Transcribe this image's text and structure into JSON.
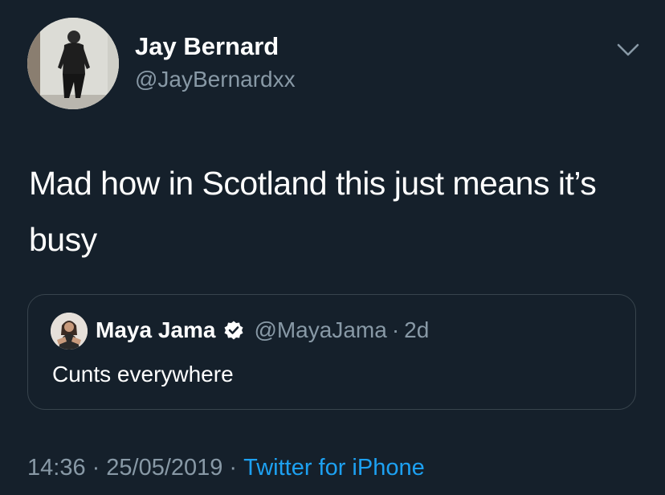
{
  "author": {
    "name": "Jay Bernard",
    "handle": "@JayBernardxx"
  },
  "tweet": {
    "text": "Mad how in Scotland this just means it’s busy"
  },
  "quoted_tweet": {
    "name": "Maya Jama",
    "handle": "@MayaJama",
    "separator": "·",
    "time": "2d",
    "text": "Cunts everywhere"
  },
  "footer": {
    "time": "14:36",
    "separator": "·",
    "date": "25/05/2019",
    "source": "Twitter for iPhone"
  },
  "colors": {
    "background": "#15202b",
    "secondary_text": "#8899a6",
    "accent": "#1da1f2",
    "border": "#38444d"
  },
  "icons": {
    "menu": "chevron-down-icon",
    "verified": "verified-badge-icon"
  }
}
